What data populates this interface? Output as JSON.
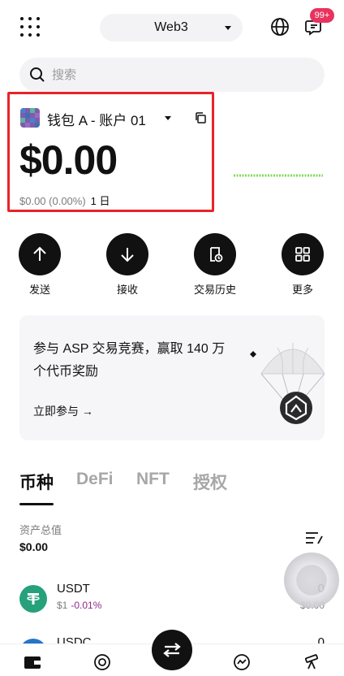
{
  "header": {
    "network_label": "Web3",
    "notification_badge": "99+",
    "icons": [
      "grid-menu-icon",
      "globe-icon",
      "message-icon"
    ]
  },
  "search": {
    "placeholder": "搜索"
  },
  "wallet": {
    "name": "钱包 A - 账户 01",
    "balance": "$0.00",
    "change": "$0.00 (0.00%)",
    "period": "1 日"
  },
  "actions": [
    {
      "label": "发送",
      "icon": "arrow-up-icon"
    },
    {
      "label": "接收",
      "icon": "arrow-down-icon"
    },
    {
      "label": "交易历史",
      "icon": "history-icon"
    },
    {
      "label": "更多",
      "icon": "grid-icon"
    }
  ],
  "promo": {
    "title": "参与 ASP 交易竞赛，赢取 140 万个代币奖励",
    "link": "立即参与 →"
  },
  "tabs": [
    "币种",
    "DeFi",
    "NFT",
    "授权"
  ],
  "assets": {
    "label": "资产总值",
    "value": "$0.00"
  },
  "tokens": [
    {
      "symbol": "USDT",
      "price": "$1",
      "change": "-0.01%",
      "amount": "0",
      "value": "$0.00"
    },
    {
      "symbol": "USDC",
      "price": "",
      "change": "",
      "amount": "0",
      "value": ""
    }
  ],
  "bottom_nav": [
    "wallet-icon",
    "discover-icon",
    "swap-icon",
    "earn-icon",
    "telescope-icon"
  ],
  "colors": {
    "accent": "#111111",
    "highlight_border": "#e8232a",
    "badge": "#e8335f",
    "sparkline": "#7ed957",
    "negative_change": "#8b2b8b",
    "usdt": "#26a17b",
    "usdc": "#2775ca"
  }
}
